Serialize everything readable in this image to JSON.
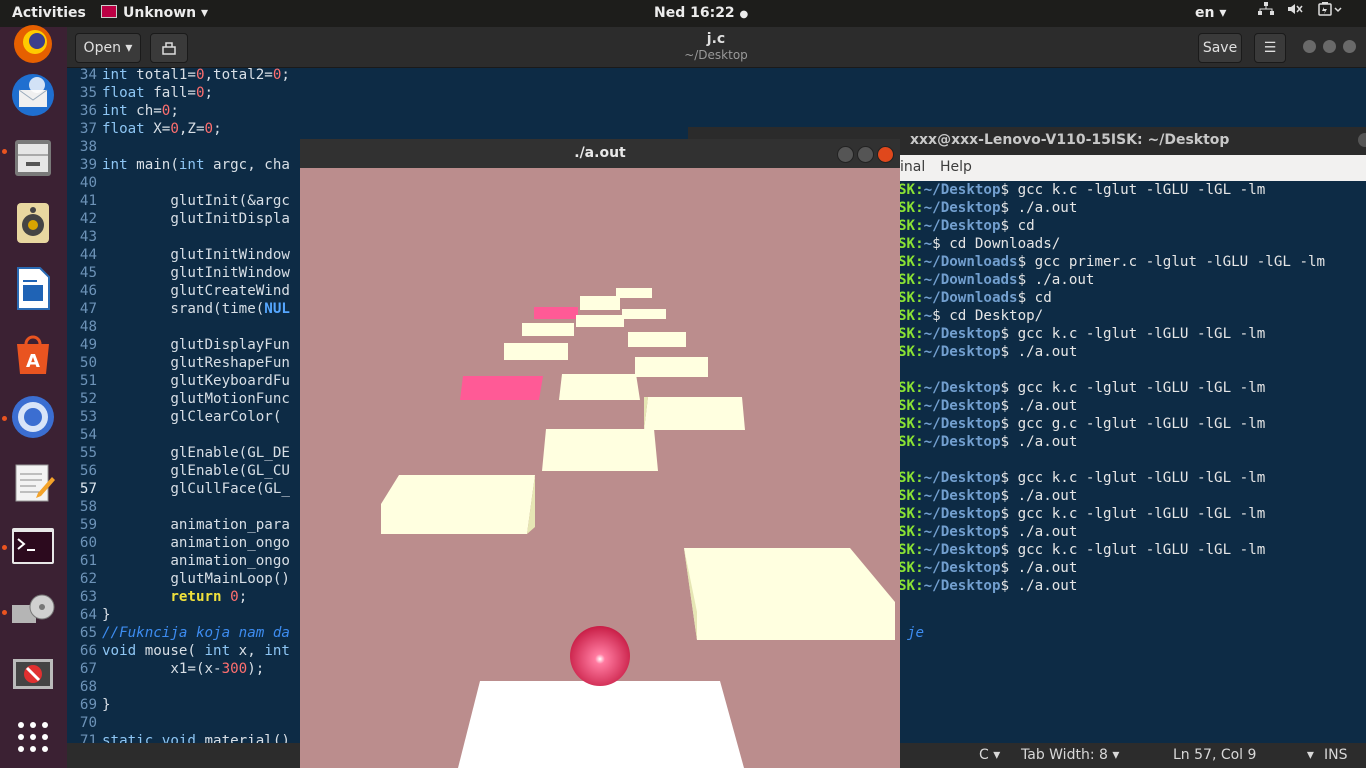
{
  "topbar": {
    "activities": "Activities",
    "app_menu": "Unknown",
    "clock": "Ned 16:22",
    "language": "en"
  },
  "editor": {
    "open_label": "Open",
    "title": "j.c",
    "subtitle": "~/Desktop",
    "save_label": "Save",
    "lines": [
      {
        "n": "34",
        "t": [
          [
            "kw",
            "int"
          ],
          [
            "p",
            " total1="
          ],
          [
            "num",
            "0"
          ],
          [
            "p",
            ",total2="
          ],
          [
            "num",
            "0"
          ],
          [
            "p",
            ";"
          ]
        ]
      },
      {
        "n": "35",
        "t": [
          [
            "kw",
            "float"
          ],
          [
            "p",
            " fall="
          ],
          [
            "num",
            "0"
          ],
          [
            "p",
            ";"
          ]
        ]
      },
      {
        "n": "36",
        "t": [
          [
            "kw",
            "int"
          ],
          [
            "p",
            " ch="
          ],
          [
            "num",
            "0"
          ],
          [
            "p",
            ";"
          ]
        ]
      },
      {
        "n": "37",
        "t": [
          [
            "kw",
            "float"
          ],
          [
            "p",
            " X="
          ],
          [
            "num",
            "0"
          ],
          [
            "p",
            ",Z="
          ],
          [
            "num",
            "0"
          ],
          [
            "p",
            ";"
          ]
        ]
      },
      {
        "n": "38",
        "t": []
      },
      {
        "n": "39",
        "t": [
          [
            "kw",
            "int"
          ],
          [
            "p",
            " main("
          ],
          [
            "kw",
            "int"
          ],
          [
            "p",
            " argc, cha"
          ]
        ]
      },
      {
        "n": "40",
        "t": []
      },
      {
        "n": "41",
        "t": [
          [
            "p",
            "        glutInit(&argc"
          ]
        ]
      },
      {
        "n": "42",
        "t": [
          [
            "p",
            "        glutInitDispla"
          ]
        ]
      },
      {
        "n": "43",
        "t": []
      },
      {
        "n": "44",
        "t": [
          [
            "p",
            "        glutInitWindow"
          ]
        ]
      },
      {
        "n": "45",
        "t": [
          [
            "p",
            "        glutInitWindow"
          ]
        ]
      },
      {
        "n": "46",
        "t": [
          [
            "p",
            "        glutCreateWind"
          ]
        ]
      },
      {
        "n": "47",
        "t": [
          [
            "p",
            "        srand(time("
          ],
          [
            "const",
            "NUL"
          ]
        ]
      },
      {
        "n": "48",
        "t": []
      },
      {
        "n": "49",
        "t": [
          [
            "p",
            "        glutDisplayFun"
          ]
        ]
      },
      {
        "n": "50",
        "t": [
          [
            "p",
            "        glutReshapeFun"
          ]
        ]
      },
      {
        "n": "51",
        "t": [
          [
            "p",
            "        glutKeyboardFu"
          ]
        ]
      },
      {
        "n": "52",
        "t": [
          [
            "p",
            "        glutMotionFunc"
          ]
        ]
      },
      {
        "n": "53",
        "t": [
          [
            "p",
            "        glClearColor( "
          ]
        ]
      },
      {
        "n": "54",
        "t": []
      },
      {
        "n": "55",
        "t": [
          [
            "p",
            "        glEnable(GL_DE"
          ]
        ]
      },
      {
        "n": "56",
        "t": [
          [
            "p",
            "        glEnable(GL_CU"
          ]
        ]
      },
      {
        "n": "57",
        "t": [
          [
            "p",
            "        glCullFace(GL_"
          ]
        ],
        "cur": true
      },
      {
        "n": "58",
        "t": []
      },
      {
        "n": "59",
        "t": [
          [
            "p",
            "        animation_para"
          ]
        ]
      },
      {
        "n": "60",
        "t": [
          [
            "p",
            "        animation_ongo"
          ]
        ]
      },
      {
        "n": "61",
        "t": [
          [
            "p",
            "        animation_ongo"
          ]
        ]
      },
      {
        "n": "62",
        "t": [
          [
            "p",
            "        glutMainLoop()"
          ]
        ]
      },
      {
        "n": "63",
        "t": [
          [
            "p",
            "        "
          ],
          [
            "kw2",
            "return"
          ],
          [
            "p",
            " "
          ],
          [
            "num",
            "0"
          ],
          [
            "p",
            ";"
          ]
        ]
      },
      {
        "n": "64",
        "t": [
          [
            "p",
            "}"
          ]
        ]
      },
      {
        "n": "65",
        "t": [
          [
            "cm",
            "//Fukncija koja nam da"
          ]
        ]
      },
      {
        "n": "66",
        "t": [
          [
            "kw",
            "void"
          ],
          [
            "p",
            " mouse( "
          ],
          [
            "kw",
            "int"
          ],
          [
            "p",
            " x, "
          ],
          [
            "kw",
            "int"
          ]
        ]
      },
      {
        "n": "67",
        "t": [
          [
            "p",
            "        x1=(x-"
          ],
          [
            "num",
            "300"
          ],
          [
            "p",
            ");"
          ]
        ]
      },
      {
        "n": "68",
        "t": []
      },
      {
        "n": "69",
        "t": [
          [
            "p",
            "}"
          ]
        ]
      },
      {
        "n": "70",
        "t": []
      },
      {
        "n": "71",
        "t": [
          [
            "kw",
            "static"
          ],
          [
            "p",
            " "
          ],
          [
            "kw",
            "void"
          ],
          [
            "p",
            " material()"
          ]
        ]
      }
    ],
    "comment_tail": "je",
    "status": {
      "language": "C",
      "tab_width": "Tab Width: 8",
      "position": "Ln 57, Col 9",
      "mode": "INS"
    }
  },
  "terminal": {
    "title": "xxx@xxx-Lenovo-V110-15ISK: ~/Desktop",
    "menu": [
      "inal",
      "Help"
    ],
    "lines": [
      {
        "p": "SK:",
        "d": "~/Desktop",
        "c": "$ gcc k.c -lglut -lGLU -lGL -lm"
      },
      {
        "p": "SK:",
        "d": "~/Desktop",
        "c": "$ ./a.out"
      },
      {
        "p": "SK:",
        "d": "~/Desktop",
        "c": "$ cd"
      },
      {
        "p": "SK:",
        "d": "~",
        "c": "$ cd Downloads/"
      },
      {
        "p": "SK:",
        "d": "~/Downloads",
        "c": "$ gcc primer.c -lglut -lGLU -lGL -lm"
      },
      {
        "p": "SK:",
        "d": "~/Downloads",
        "c": "$ ./a.out"
      },
      {
        "p": "SK:",
        "d": "~/Downloads",
        "c": "$ cd"
      },
      {
        "p": "SK:",
        "d": "~",
        "c": "$ cd Desktop/"
      },
      {
        "p": "SK:",
        "d": "~/Desktop",
        "c": "$ gcc k.c -lglut -lGLU -lGL -lm"
      },
      {
        "p": "SK:",
        "d": "~/Desktop",
        "c": "$ ./a.out"
      },
      {
        "p": "",
        "d": "",
        "c": ""
      },
      {
        "p": "SK:",
        "d": "~/Desktop",
        "c": "$ gcc k.c -lglut -lGLU -lGL -lm"
      },
      {
        "p": "SK:",
        "d": "~/Desktop",
        "c": "$ ./a.out"
      },
      {
        "p": "SK:",
        "d": "~/Desktop",
        "c": "$ gcc g.c -lglut -lGLU -lGL -lm"
      },
      {
        "p": "SK:",
        "d": "~/Desktop",
        "c": "$ ./a.out"
      },
      {
        "p": "",
        "d": "",
        "c": ""
      },
      {
        "p": "SK:",
        "d": "~/Desktop",
        "c": "$ gcc k.c -lglut -lGLU -lGL -lm"
      },
      {
        "p": "SK:",
        "d": "~/Desktop",
        "c": "$ ./a.out"
      },
      {
        "p": "SK:",
        "d": "~/Desktop",
        "c": "$ gcc k.c -lglut -lGLU -lGL -lm"
      },
      {
        "p": "SK:",
        "d": "~/Desktop",
        "c": "$ ./a.out"
      },
      {
        "p": "SK:",
        "d": "~/Desktop",
        "c": "$ gcc k.c -lglut -lGLU -lGL -lm"
      },
      {
        "p": "SK:",
        "d": "~/Desktop",
        "c": "$ ./a.out"
      },
      {
        "p": "SK:",
        "d": "~/Desktop",
        "c": "$ ./a.out"
      }
    ]
  },
  "aout": {
    "title": "./a.out",
    "colors": {
      "background": "#bb8d8d",
      "platform": "#ffffe0",
      "platform_side": "#e6e6b4",
      "pink_platform": "#ff5a96",
      "ball": "#f0325a"
    }
  },
  "dock": {
    "icons": [
      "firefox-icon",
      "thunderbird-icon",
      "files-icon",
      "rhythmbox-icon",
      "writer-icon",
      "software-center-icon",
      "chromium-icon",
      "text-editor-icon",
      "terminal-icon",
      "usb-creator-icon",
      "blocked-app-icon",
      "show-apps-icon"
    ]
  }
}
